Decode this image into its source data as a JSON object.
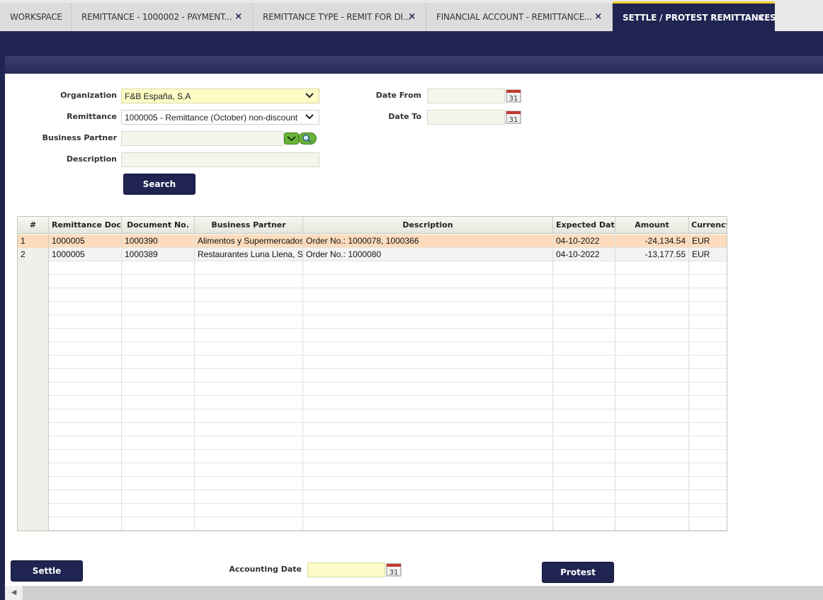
{
  "tabs": [
    {
      "label": "WORKSPACE",
      "closable": false
    },
    {
      "label": "REMITTANCE - 1000002 - PAYMENT...",
      "closable": true
    },
    {
      "label": "REMITTANCE TYPE - REMIT FOR DI...",
      "closable": true
    },
    {
      "label": "FINANCIAL ACCOUNT - REMITTANCE...",
      "closable": true
    },
    {
      "label": "SETTLE / PROTEST REMITTANCES",
      "closable": true,
      "active": true
    }
  ],
  "close_glyph": "×",
  "form": {
    "organization_label": "Organization",
    "organization_value": "F&B España, S.A",
    "remittance_label": "Remittance",
    "remittance_value": "1000005 - Remittance (October) non-discount",
    "business_partner_label": "Business Partner",
    "business_partner_value": "",
    "description_label": "Description",
    "description_value": "",
    "date_from_label": "Date From",
    "date_from_value": "",
    "date_to_label": "Date To",
    "date_to_value": "",
    "calendar_glyph": "31",
    "search_label": "Search"
  },
  "grid": {
    "columns": [
      "#",
      "Remittance  Docu",
      "Document  No.",
      "Business  Partner",
      "Description",
      "Expected  Date",
      "Amount",
      "Currency"
    ],
    "rows": [
      {
        "num": "1",
        "remittance": "1000005",
        "document_no": "1000390",
        "business_partner": "Alimentos y Supermercados",
        "description": "Order No.: 1000078, 1000366",
        "expected_date": "04-10-2022",
        "amount": "-24,134.54",
        "currency": "EUR",
        "selected": true
      },
      {
        "num": "2",
        "remittance": "1000005",
        "document_no": "1000389",
        "business_partner": "Restaurantes Luna Llena, S",
        "description": "Order No.: 1000080",
        "expected_date": "04-10-2022",
        "amount": "-13,177.55",
        "currency": "EUR",
        "selected": false
      }
    ],
    "empty_rows": 20
  },
  "footer": {
    "settle_label": "Settle",
    "accounting_date_label": "Accounting Date",
    "accounting_date_value": "",
    "protest_label": "Protest"
  },
  "colors": {
    "brand_navy": "#1f2451",
    "active_tab_accent": "#f0cf2b",
    "selected_row": "#fcdcbd",
    "required_field": "#fdfcc6"
  }
}
